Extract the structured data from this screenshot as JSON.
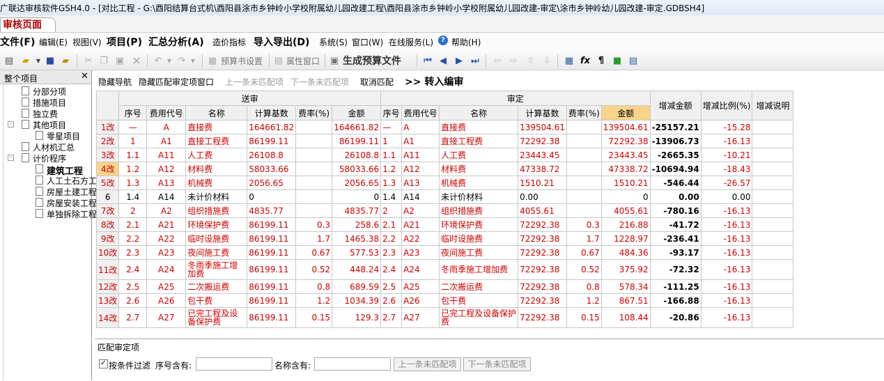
{
  "window": {
    "title": "广联达审核软件GSH4.0 - [对比工程 - G:\\酉阳结算台式机\\酉阳县涂市乡钟岭小学校附属幼儿园改建工程\\酉阳县涂市乡钟岭小学校附属幼儿园改建-审定\\涂市乡钟岭幼儿园改建-审定.GDBSH4]"
  },
  "page_tab": "审核页面",
  "menu": [
    {
      "label": "文件(F)",
      "big": true
    },
    {
      "label": "编辑(E)"
    },
    {
      "label": "视图(V)"
    },
    {
      "label": "项目(P)",
      "big": true
    },
    {
      "label": "汇总分析(A)",
      "big": true
    },
    {
      "label": "造价指标"
    },
    {
      "label": "导入导出(D)",
      "big": true
    },
    {
      "label": "系统(S)"
    },
    {
      "label": "窗口(W)"
    },
    {
      "label": "在线服务(L)"
    },
    {
      "label": "帮助(H)"
    }
  ],
  "toolbar": {
    "budget_settings": "预算书设置",
    "property_window": "属性窗口",
    "generate_budget": "生成预算文件"
  },
  "left_panel": {
    "title": "整个项目",
    "tree": [
      {
        "label": "分部分项",
        "level": 1
      },
      {
        "label": "措施项目",
        "level": 1
      },
      {
        "label": "独立费",
        "level": 1
      },
      {
        "label": "其他项目",
        "level": 0,
        "expander": "-"
      },
      {
        "label": "零星项目",
        "level": 2
      },
      {
        "label": "人材机汇总",
        "level": 1
      },
      {
        "label": "计价程序",
        "level": 0,
        "expander": "-"
      },
      {
        "label": "建筑工程",
        "level": 2,
        "selected": true
      },
      {
        "label": "人工土石方工",
        "level": 2
      },
      {
        "label": "房屋土建工程",
        "level": 2
      },
      {
        "label": "房屋安装工程",
        "level": 2
      },
      {
        "label": "单独拆除工程",
        "level": 2
      }
    ]
  },
  "action_bar": {
    "hide_nav": "隐藏导航",
    "hide_match_window": "隐藏匹配审定项窗口",
    "prev_unmatched": "上一条未匹配项",
    "next_unmatched": "下一条未匹配项",
    "cancel_match": "取消匹配",
    "to_editor": ">> 转入编审"
  },
  "table": {
    "group_submitted": "送审",
    "group_approved": "审定",
    "headers": [
      "序号",
      "费用代号",
      "名称",
      "计算基数",
      "费率(%)",
      "金额",
      "序号",
      "费用代号",
      "名称",
      "计算基数",
      "费率(%)",
      "金额",
      "增减金额",
      "增减比例(%)",
      "增减说明"
    ],
    "rows": [
      {
        "rn": "1改",
        "c": [
          "—",
          "A",
          "直接费",
          "164661.82",
          "",
          "164661.82",
          "—",
          "A",
          "直接费",
          "139504.61",
          "",
          "139504.61",
          "-25157.21",
          "-15.28",
          ""
        ],
        "changed": true
      },
      {
        "rn": "2改",
        "c": [
          "1",
          "A1",
          "直接工程费",
          "86199.11",
          "",
          "86199.11",
          "1",
          "A1",
          "直接工程费",
          "72292.38",
          "",
          "72292.38",
          "-13906.73",
          "-16.13",
          ""
        ],
        "changed": true
      },
      {
        "rn": "3改",
        "c": [
          "1.1",
          "A11",
          "人工费",
          "26108.8",
          "",
          "26108.8",
          "1.1",
          "A11",
          "人工费",
          "23443.45",
          "",
          "23443.45",
          "-2665.35",
          "-10.21",
          ""
        ],
        "changed": true
      },
      {
        "rn": "4改",
        "c": [
          "1.2",
          "A12",
          "材料费",
          "58033.66",
          "",
          "58033.66",
          "1.2",
          "A12",
          "材料费",
          "47338.72",
          "",
          "47338.72",
          "-10694.94",
          "-18.43",
          ""
        ],
        "changed": true,
        "current": true
      },
      {
        "rn": "5改",
        "c": [
          "1.3",
          "A13",
          "机械费",
          "2056.65",
          "",
          "2056.65",
          "1.3",
          "A13",
          "机械费",
          "1510.21",
          "",
          "1510.21",
          "-546.44",
          "-26.57",
          ""
        ],
        "changed": true
      },
      {
        "rn": "6",
        "c": [
          "1.4",
          "A14",
          "未计价材料",
          "0",
          "",
          "0",
          "1.4",
          "A14",
          "未计价材料",
          "0.00",
          "",
          "0",
          "0.00",
          "0.00",
          ""
        ],
        "changed": false
      },
      {
        "rn": "7改",
        "c": [
          "2",
          "A2",
          "组织措施费",
          "4835.77",
          "",
          "4835.77",
          "2",
          "A2",
          "组织措施费",
          "4055.61",
          "",
          "4055.61",
          "-780.16",
          "-16.13",
          ""
        ],
        "changed": true
      },
      {
        "rn": "8改",
        "c": [
          "2.1",
          "A21",
          "环境保护费",
          "86199.11",
          "0.3",
          "258.6",
          "2.1",
          "A21",
          "环境保护费",
          "72292.38",
          "0.3",
          "216.88",
          "-41.72",
          "-16.13",
          ""
        ],
        "changed": true
      },
      {
        "rn": "9改",
        "c": [
          "2.2",
          "A22",
          "临时设施费",
          "86199.11",
          "1.7",
          "1465.38",
          "2.2",
          "A22",
          "临时设施费",
          "72292.38",
          "1.7",
          "1228.97",
          "-236.41",
          "-16.13",
          ""
        ],
        "changed": true
      },
      {
        "rn": "10改",
        "c": [
          "2.3",
          "A23",
          "夜间施工费",
          "86199.11",
          "0.67",
          "577.53",
          "2.3",
          "A23",
          "夜间施工费",
          "72292.38",
          "0.67",
          "484.36",
          "-93.17",
          "-16.13",
          ""
        ],
        "changed": true
      },
      {
        "rn": "11改",
        "c": [
          "2.4",
          "A24",
          "冬雨季施工增加费",
          "86199.11",
          "0.52",
          "448.24",
          "2.4",
          "A24",
          "冬雨季施工增加费",
          "72292.38",
          "0.52",
          "375.92",
          "-72.32",
          "-16.13",
          ""
        ],
        "changed": true,
        "tall": true
      },
      {
        "rn": "12改",
        "c": [
          "2.5",
          "A25",
          "二次搬运费",
          "86199.11",
          "0.8",
          "689.59",
          "2.5",
          "A25",
          "二次搬运费",
          "72292.38",
          "0.8",
          "578.34",
          "-111.25",
          "-16.13",
          ""
        ],
        "changed": true
      },
      {
        "rn": "13改",
        "c": [
          "2.6",
          "A26",
          "包干费",
          "86199.11",
          "1.2",
          "1034.39",
          "2.6",
          "A26",
          "包干费",
          "72292.38",
          "1.2",
          "867.51",
          "-166.88",
          "-16.13",
          ""
        ],
        "changed": true
      },
      {
        "rn": "14改",
        "c": [
          "2.7",
          "A27",
          "已完工程及设备保护费",
          "86199.11",
          "0.15",
          "129.3",
          "2.7",
          "A27",
          "已完工程及设备保护费",
          "72292.38",
          "0.15",
          "108.44",
          "-20.86",
          "-16.13",
          ""
        ],
        "changed": true,
        "tall": true
      }
    ]
  },
  "bottom_panel": {
    "title": "匹配审定项",
    "filter_label": "按条件过滤",
    "seq_label": "序号含有:",
    "name_label": "名称含有:",
    "prev_btn": "上一条未匹配项",
    "next_btn": "下一条未匹配项"
  },
  "colors": {
    "changed_text": "#d00000",
    "highlight": "#f8d48a",
    "tab_text": "#b00000"
  }
}
